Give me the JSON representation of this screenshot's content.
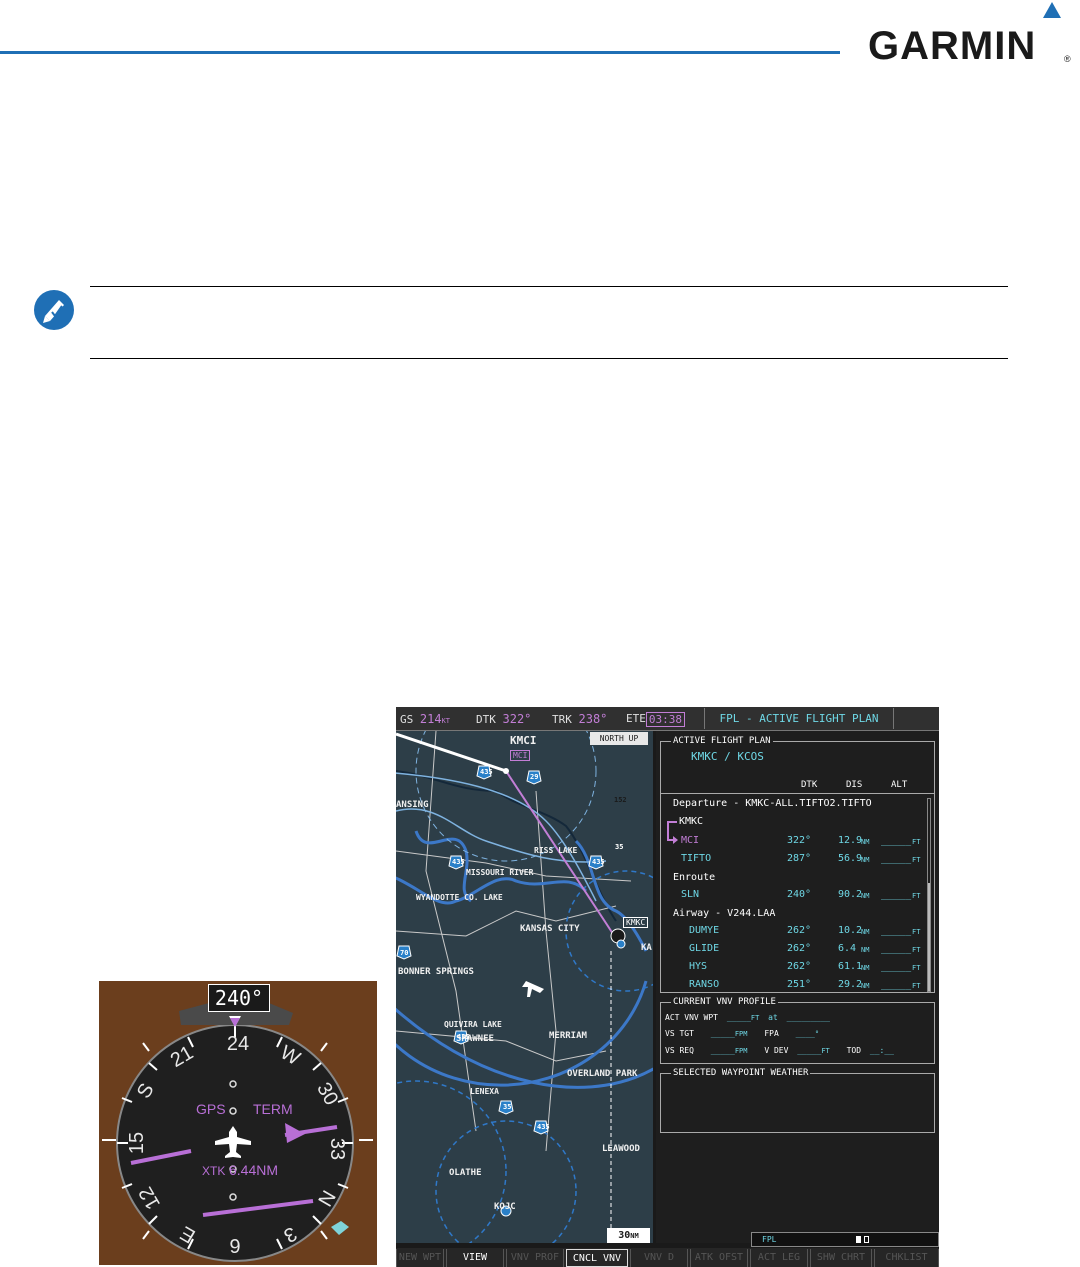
{
  "brand": {
    "name": "GARMIN",
    "registered": "®",
    "accent_color": "#1f6fb5"
  },
  "note": {
    "icon": "checkmark-note-icon"
  },
  "hsi": {
    "heading": "240°",
    "compass": [
      "24",
      "W",
      "30",
      "33",
      "N",
      "3",
      "E",
      "12",
      "15",
      "S",
      "21",
      "6"
    ],
    "nav_source": "GPS",
    "flight_phase": "TERM",
    "xtk_label": "XTK",
    "xtk_value": "6.44NM",
    "colors": {
      "background": "#6b3e1d",
      "course": "#b86fd6",
      "bearing": "#7fd3d9"
    }
  },
  "mfd": {
    "topbar": {
      "gs_label": "GS",
      "gs_value": "214",
      "gs_unit": "KT",
      "dtk_label": "DTK",
      "dtk_value": "322°",
      "trk_label": "TRK",
      "trk_value": "238°",
      "ete_label": "ETE",
      "ete_value": "03:38",
      "page_title": "FPL - ACTIVE FLIGHT PLAN"
    },
    "map": {
      "orientation": "NORTH UP",
      "range": "30",
      "range_unit": "NM",
      "labels": {
        "kmci": "KMCI",
        "mci": "MCI",
        "lansing": "ANSING",
        "riss_lake": "RISS LAKE",
        "missouri_river": "MISSOURI RIVER",
        "wyandotte": "WYANDOTTE CO. LAKE",
        "kansas_city": "KANSAS CITY",
        "kmkc": "KMKC",
        "kc_short": "KA",
        "bonner": "BONNER SPRINGS",
        "quivira": "QUIVIRA LAKE",
        "shawnee": "SHAWNEE",
        "merriam": "MERRIAM",
        "overland": "OVERLAND PARK",
        "lenexa": "LENEXA",
        "leawood": "LEAWOOD",
        "olathe": "OLATHE",
        "kojc": "KOJC"
      },
      "shields": {
        "i435a": "435",
        "i29": "29",
        "i152": "152",
        "i35a": "35",
        "i435b": "435",
        "i435c": "435",
        "i70": "70",
        "i435d": "435",
        "i35b": "35",
        "i435e": "435"
      }
    },
    "active_fpl": {
      "box_title": "ACTIVE FLIGHT PLAN",
      "route": "KMKC / KCOS",
      "col_dtk": "DTK",
      "col_dis": "DIS",
      "col_alt": "ALT",
      "departure": "Departure - KMKC-ALL.TIFTO2.TIFTO",
      "origin": "KMKC",
      "legs": [
        {
          "wpt": "MCI",
          "dtk": "322°",
          "dis": "12.9",
          "unit": "NM",
          "alt": "_____",
          "alt_unit": "FT"
        },
        {
          "wpt": "TIFTO",
          "dtk": "287°",
          "dis": "56.9",
          "unit": "NM",
          "alt": "_____",
          "alt_unit": "FT"
        }
      ],
      "enroute": "Enroute",
      "enroute_legs": [
        {
          "wpt": "SLN",
          "dtk": "240°",
          "dis": "90.2",
          "unit": "NM",
          "alt": "_____",
          "alt_unit": "FT"
        }
      ],
      "airway": "Airway - V244.LAA",
      "airway_legs": [
        {
          "wpt": "DUMYE",
          "dtk": "262°",
          "dis": "10.2",
          "unit": "NM",
          "alt": "_____",
          "alt_unit": "FT"
        },
        {
          "wpt": "GLIDE",
          "dtk": "262°",
          "dis": "6.4",
          "unit": "NM",
          "alt": "_____",
          "alt_unit": "FT"
        },
        {
          "wpt": "HYS",
          "dtk": "262°",
          "dis": "61.1",
          "unit": "NM",
          "alt": "_____",
          "alt_unit": "FT"
        },
        {
          "wpt": "RANSO",
          "dtk": "251°",
          "dis": "29.2",
          "unit": "NM",
          "alt": "_____",
          "alt_unit": "FT"
        }
      ]
    },
    "vnv": {
      "box_title": "CURRENT VNV PROFILE",
      "act_label": "ACT VNV WPT",
      "act_alt": "_____",
      "act_alt_unit": "FT",
      "at": "at",
      "act_wpt": "_________",
      "vs_tgt_label": "VS TGT",
      "vs_tgt": "_____",
      "vs_tgt_unit": "FPM",
      "fpa_label": "FPA",
      "fpa": "____",
      "fpa_unit": "°",
      "vs_req_label": "VS REQ",
      "vs_req": "_____",
      "vs_req_unit": "FPM",
      "vdev_label": "V DEV",
      "vdev": "_____",
      "vdev_unit": "FT",
      "tod_label": "TOD",
      "tod": "__:__"
    },
    "wx": {
      "box_title": "SELECTED WAYPOINT WEATHER"
    },
    "fpl_bar": "FPL",
    "softkeys": [
      "NEW WPT",
      "VIEW",
      "VNV PROF",
      "CNCL VNV",
      "VNV D",
      "ATK OFST",
      "ACT LEG",
      "SHW CHRT",
      "CHKLIST"
    ]
  }
}
